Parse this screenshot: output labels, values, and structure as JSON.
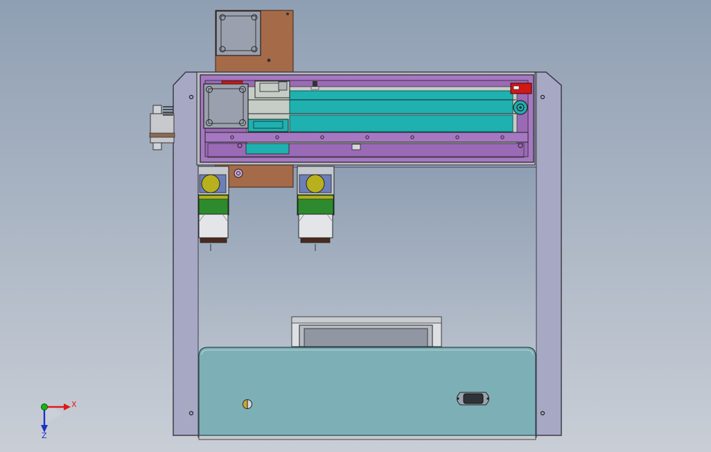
{
  "viewport": {
    "background_top": "#8f9fb3",
    "background_bottom": "#c9ced6"
  },
  "triad": {
    "x_label": "X",
    "z_label": "Z",
    "x_color": "#e01818",
    "y_color": "#18b418",
    "z_color": "#1a32c8"
  },
  "colors": {
    "frame": "#a7a8c4",
    "frame_edge": "#3b3b4a",
    "copper_plate": "#a56a48",
    "purple_carriage": "#a678c2",
    "teal_belt": "#1fb0b0",
    "cabinet": "#7dafb6",
    "stepper": "#9aa0ad",
    "pcb_green": "#2e8a2e",
    "yellow_rotor": "#b8b01c",
    "limit_switch": "#d01818",
    "nozzle_brown": "#4a2a1c"
  }
}
